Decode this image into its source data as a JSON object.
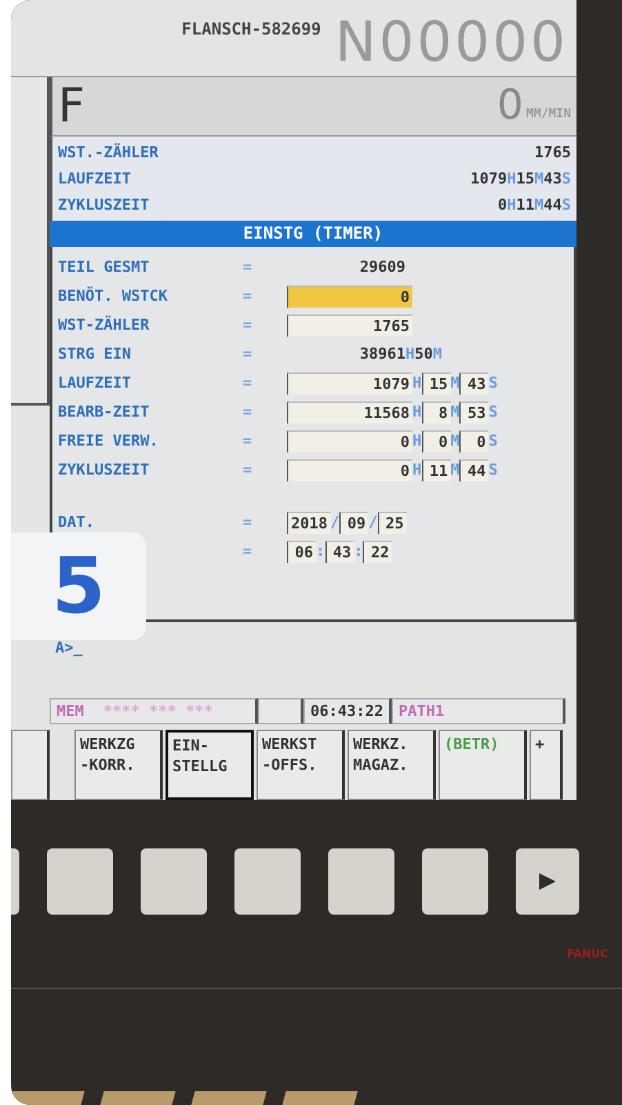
{
  "header": {
    "program": "FLANSCH-582699",
    "sequence": "N00000"
  },
  "feed": {
    "letter": "F",
    "value": "0",
    "unit": "MM/MIN"
  },
  "info_rows": [
    {
      "label": "WST.-ZÄHLER",
      "value": [
        {
          "text": "1765",
          "kind": "num"
        }
      ]
    },
    {
      "label": "LAUFZEIT",
      "value": [
        {
          "text": "1079",
          "kind": "num"
        },
        {
          "text": "H",
          "kind": "unit"
        },
        {
          "text": "15",
          "kind": "num"
        },
        {
          "text": "M",
          "kind": "unit"
        },
        {
          "text": "43",
          "kind": "num"
        },
        {
          "text": "S",
          "kind": "unit"
        }
      ]
    },
    {
      "label": "ZYKLUSZEIT",
      "value": [
        {
          "text": "0",
          "kind": "num"
        },
        {
          "text": "H",
          "kind": "unit"
        },
        {
          "text": "11",
          "kind": "num"
        },
        {
          "text": "M",
          "kind": "unit"
        },
        {
          "text": "44",
          "kind": "num"
        },
        {
          "text": "S",
          "kind": "unit"
        }
      ]
    }
  ],
  "panel": {
    "title": "EINSTG (TIMER)",
    "rows": [
      {
        "label": "TEIL GESMT",
        "eq": "=",
        "kind": "value",
        "value": [
          {
            "text": "29609",
            "kind": "num"
          }
        ]
      },
      {
        "label": "BENÖT. WSTCK",
        "eq": "=",
        "kind": "value",
        "value": [
          {
            "text": "0",
            "kind": "field",
            "selected": true
          }
        ]
      },
      {
        "label": "WST-ZÄHLER",
        "eq": "=",
        "kind": "value",
        "value": [
          {
            "text": "1765",
            "kind": "field",
            "selected": false
          }
        ]
      },
      {
        "label": "STRG EIN",
        "eq": "=",
        "kind": "value",
        "value": [
          {
            "text": "38961",
            "kind": "num"
          },
          {
            "text": "H",
            "kind": "unit"
          },
          {
            "text": "50",
            "kind": "num"
          },
          {
            "text": "M",
            "kind": "unit"
          }
        ]
      },
      {
        "label": "LAUFZEIT",
        "eq": "=",
        "kind": "value",
        "value": [
          {
            "text": "1079",
            "kind": "field",
            "selected": false
          },
          {
            "text": "H",
            "kind": "unit"
          },
          {
            "text": "15",
            "kind": "field",
            "selected": false
          },
          {
            "text": "M",
            "kind": "unit"
          },
          {
            "text": "43",
            "kind": "field",
            "selected": false
          },
          {
            "text": "S",
            "kind": "unit"
          }
        ]
      },
      {
        "label": "BEARB-ZEIT",
        "eq": "=",
        "kind": "value",
        "value": [
          {
            "text": "11568",
            "kind": "field",
            "selected": false
          },
          {
            "text": "H",
            "kind": "unit"
          },
          {
            "text": "8",
            "kind": "field",
            "selected": false
          },
          {
            "text": "M",
            "kind": "unit"
          },
          {
            "text": "53",
            "kind": "field",
            "selected": false
          },
          {
            "text": "S",
            "kind": "unit"
          }
        ]
      },
      {
        "label": "FREIE VERW.",
        "eq": "=",
        "kind": "value",
        "value": [
          {
            "text": "0",
            "kind": "field",
            "selected": false
          },
          {
            "text": "H",
            "kind": "unit"
          },
          {
            "text": "0",
            "kind": "field",
            "selected": false
          },
          {
            "text": "M",
            "kind": "unit"
          },
          {
            "text": "0",
            "kind": "field",
            "selected": false
          },
          {
            "text": "S",
            "kind": "unit"
          }
        ]
      },
      {
        "label": "ZYKLUSZEIT",
        "eq": "=",
        "kind": "value",
        "value": [
          {
            "text": "0",
            "kind": "field",
            "selected": false
          },
          {
            "text": "H",
            "kind": "unit"
          },
          {
            "text": "11",
            "kind": "field",
            "selected": false
          },
          {
            "text": "M",
            "kind": "unit"
          },
          {
            "text": "44",
            "kind": "field",
            "selected": false
          },
          {
            "text": "S",
            "kind": "unit"
          }
        ]
      },
      {
        "label": "DAT.",
        "eq": "=",
        "kind": "date",
        "value": [
          {
            "text": "2018",
            "kind": "field",
            "selected": false
          },
          {
            "text": "/",
            "kind": "unit"
          },
          {
            "text": "09",
            "kind": "field",
            "selected": false
          },
          {
            "text": "/",
            "kind": "unit"
          },
          {
            "text": "25",
            "kind": "field",
            "selected": false
          }
        ]
      },
      {
        "eq": "=",
        "kind": "date",
        "value": [
          {
            "text": "06",
            "kind": "field",
            "selected": false
          },
          {
            "text": ":",
            "kind": "unit"
          },
          {
            "text": "43",
            "kind": "field",
            "selected": false
          },
          {
            "text": ":",
            "kind": "unit"
          },
          {
            "text": "22",
            "kind": "field",
            "selected": false
          }
        ]
      }
    ]
  },
  "step_badge": "5",
  "command_line": "A>_",
  "status_bar": {
    "mode": "MEM",
    "indicator": "**** *** ***",
    "time": "06:43:22",
    "path": "PATH1"
  },
  "softkeys": [
    {
      "lines": [
        "WERKZG",
        "-KORR."
      ],
      "kind": "menu",
      "selected": false
    },
    {
      "lines": [
        "EIN-",
        "STELLG"
      ],
      "kind": "menu",
      "selected": true
    },
    {
      "lines": [
        "WERKST",
        "-OFFS."
      ],
      "kind": "menu",
      "selected": false
    },
    {
      "lines": [
        "WERKZ.",
        "MAGAZ."
      ],
      "kind": "menu",
      "selected": false
    },
    {
      "lines": [
        "(BETR)"
      ],
      "kind": "operation",
      "selected": false
    },
    {
      "lines": [
        "+"
      ],
      "kind": "more",
      "selected": false
    }
  ],
  "brand": "FANUC"
}
